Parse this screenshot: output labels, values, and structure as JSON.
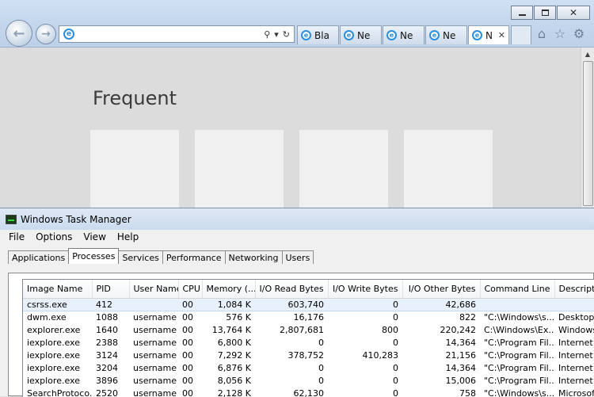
{
  "browser": {
    "address": {
      "value": "",
      "placeholder": ""
    },
    "address_tools": {
      "search": "⚲",
      "dropdown": "▾",
      "refresh": "↻"
    },
    "tabs": [
      {
        "label": "Bla"
      },
      {
        "label": "Ne"
      },
      {
        "label": "Ne"
      },
      {
        "label": "Ne"
      },
      {
        "label": "N",
        "active": true,
        "close": "✕"
      }
    ],
    "content": {
      "heading": "Frequent"
    },
    "icons": [
      "back-arrow-icon",
      "forward-arrow-icon",
      "home-icon",
      "favorites-star-icon",
      "tools-gear-icon"
    ]
  },
  "task_manager": {
    "title": "Windows Task Manager",
    "menu": [
      "File",
      "Options",
      "View",
      "Help"
    ],
    "tabs": [
      {
        "label": "Applications"
      },
      {
        "label": "Processes",
        "active": true
      },
      {
        "label": "Services"
      },
      {
        "label": "Performance"
      },
      {
        "label": "Networking"
      },
      {
        "label": "Users"
      }
    ],
    "columns": [
      "Image Name",
      "PID",
      "User Name",
      "CPU",
      "Memory (...",
      "I/O Read Bytes",
      "I/O Write Bytes",
      "I/O Other Bytes",
      "Command Line",
      "Description"
    ],
    "rows": [
      {
        "image": "csrss.exe",
        "pid": "412",
        "user": "",
        "cpu": "00",
        "memory": "1,084 K",
        "read": "603,740",
        "write": "0",
        "other": "42,686",
        "cmd": "",
        "desc": "",
        "selected": true
      },
      {
        "image": "dwm.exe",
        "pid": "1088",
        "user": "username",
        "cpu": "00",
        "memory": "576 K",
        "read": "16,176",
        "write": "0",
        "other": "822",
        "cmd": "\"C:\\Windows\\s...",
        "desc": "Desktop W"
      },
      {
        "image": "explorer.exe",
        "pid": "1640",
        "user": "username",
        "cpu": "00",
        "memory": "13,764 K",
        "read": "2,807,681",
        "write": "800",
        "other": "220,242",
        "cmd": "C:\\Windows\\Ex...",
        "desc": "Windows E"
      },
      {
        "image": "iexplore.exe",
        "pid": "2388",
        "user": "username",
        "cpu": "00",
        "memory": "6,800 K",
        "read": "0",
        "write": "0",
        "other": "14,364",
        "cmd": "\"C:\\Program Fil...",
        "desc": "Internet E"
      },
      {
        "image": "iexplore.exe",
        "pid": "3124",
        "user": "username",
        "cpu": "00",
        "memory": "7,292 K",
        "read": "378,752",
        "write": "410,283",
        "other": "21,156",
        "cmd": "\"C:\\Program Fil...",
        "desc": "Internet E"
      },
      {
        "image": "iexplore.exe",
        "pid": "3204",
        "user": "username",
        "cpu": "00",
        "memory": "6,876 K",
        "read": "0",
        "write": "0",
        "other": "14,364",
        "cmd": "\"C:\\Program Fil...",
        "desc": "Internet E"
      },
      {
        "image": "iexplore.exe",
        "pid": "3896",
        "user": "username",
        "cpu": "00",
        "memory": "8,056 K",
        "read": "0",
        "write": "0",
        "other": "15,006",
        "cmd": "\"C:\\Program Fil...",
        "desc": "Internet E"
      },
      {
        "image": "SearchProtoco...",
        "pid": "2520",
        "user": "username",
        "cpu": "00",
        "memory": "2,128 K",
        "read": "62,130",
        "write": "0",
        "other": "758",
        "cmd": "\"C:\\Windows\\s...",
        "desc": "Microsoft"
      }
    ]
  }
}
